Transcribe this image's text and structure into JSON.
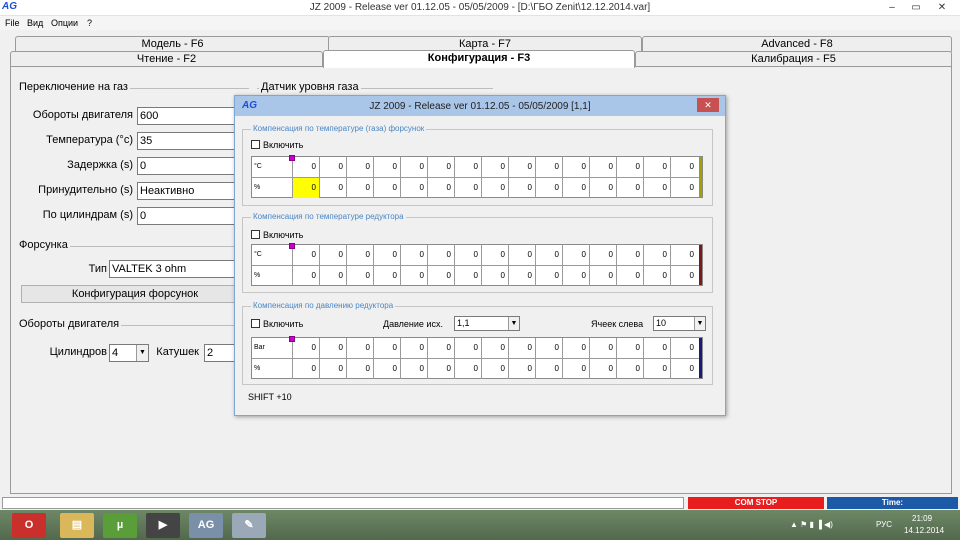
{
  "window": {
    "logo": "AG",
    "title": "JZ 2009  - Release  ver 01.12.05 - 05/05/2009  - [D:\\ГБО Zenit\\12.12.2014.var]",
    "minimize": "–",
    "restore": "▭",
    "close": "✕"
  },
  "menu": [
    "File",
    "Вид",
    "Опции",
    "?"
  ],
  "tabs": {
    "row1": [
      "Модель - F6",
      "Карта - F7",
      "Advanced - F8"
    ],
    "row2": [
      "Чтение - F2",
      "Конфигурация - F3",
      "Калибрация - F5"
    ]
  },
  "gas_switch": {
    "title": "Переключение на газ",
    "fields": [
      {
        "label": "Обороты двигателя",
        "value": "600"
      },
      {
        "label": "Температура (°c)",
        "value": "35"
      },
      {
        "label": "Задержка (s)",
        "value": "0"
      },
      {
        "label": "Принудительно (s)",
        "value": "Неактивно"
      },
      {
        "label": "По цилиндрам (s)",
        "value": "0"
      }
    ]
  },
  "gas_level": {
    "title": "Датчик уровня газа"
  },
  "injector": {
    "title": "Форсунка",
    "type_label": "Тип",
    "type_value": "VALTEK 3 ohm",
    "config_button": "Конфигурация форсунок"
  },
  "engine_rpm": {
    "title": "Обороты двигателя",
    "cylinders_label": "Цилиндров",
    "cylinders_value": "4",
    "coils_label": "Катушек",
    "coils_value": "2"
  },
  "dialog": {
    "logo": "AG",
    "title": "JZ 2009  - Release  ver 01.12.05 - 05/05/2009   [1,1]",
    "close": "✕",
    "enable_label": "Включить",
    "sections": [
      {
        "title": "Компенсация по температуре (газа) форсунок",
        "row1_unit": "°C",
        "row2_unit": "%",
        "row1": [
          "0",
          "0",
          "0",
          "0",
          "0",
          "0",
          "0",
          "0",
          "0",
          "0",
          "0",
          "0",
          "0",
          "0",
          "0"
        ],
        "row2": [
          "0",
          "0",
          "0",
          "0",
          "0",
          "0",
          "0",
          "0",
          "0",
          "0",
          "0",
          "0",
          "0",
          "0",
          "0"
        ],
        "edge_color": "#a3a100",
        "highlight_color": "#ffff00"
      },
      {
        "title": "Компенсация по температуре редуктора",
        "row1_unit": "°C",
        "row2_unit": "%",
        "row1": [
          "0",
          "0",
          "0",
          "0",
          "0",
          "0",
          "0",
          "0",
          "0",
          "0",
          "0",
          "0",
          "0",
          "0",
          "0"
        ],
        "row2": [
          "0",
          "0",
          "0",
          "0",
          "0",
          "0",
          "0",
          "0",
          "0",
          "0",
          "0",
          "0",
          "0",
          "0",
          "0"
        ],
        "edge_color": "#7a1a1a"
      },
      {
        "title": "Компенсация по давлению редуктора",
        "row1_unit": "Bar",
        "row2_unit": "%",
        "row1": [
          "0",
          "0",
          "0",
          "0",
          "0",
          "0",
          "0",
          "0",
          "0",
          "0",
          "0",
          "0",
          "0",
          "0",
          "0"
        ],
        "row2": [
          "0",
          "0",
          "0",
          "0",
          "0",
          "0",
          "0",
          "0",
          "0",
          "0",
          "0",
          "0",
          "0",
          "0",
          "0"
        ],
        "edge_color": "#1a1a7a",
        "pressure_label": "Давление исх.",
        "pressure_value": "1,1",
        "cells_label": "Ячеек слева",
        "cells_value": "10"
      }
    ],
    "footer": "SHIFT +10"
  },
  "status": {
    "com": "COM STOP",
    "time": "Time:"
  },
  "taskbar": {
    "lang": "РУС",
    "clock_time": "21:09",
    "clock_date": "14.12.2014",
    "ag": "AG"
  }
}
